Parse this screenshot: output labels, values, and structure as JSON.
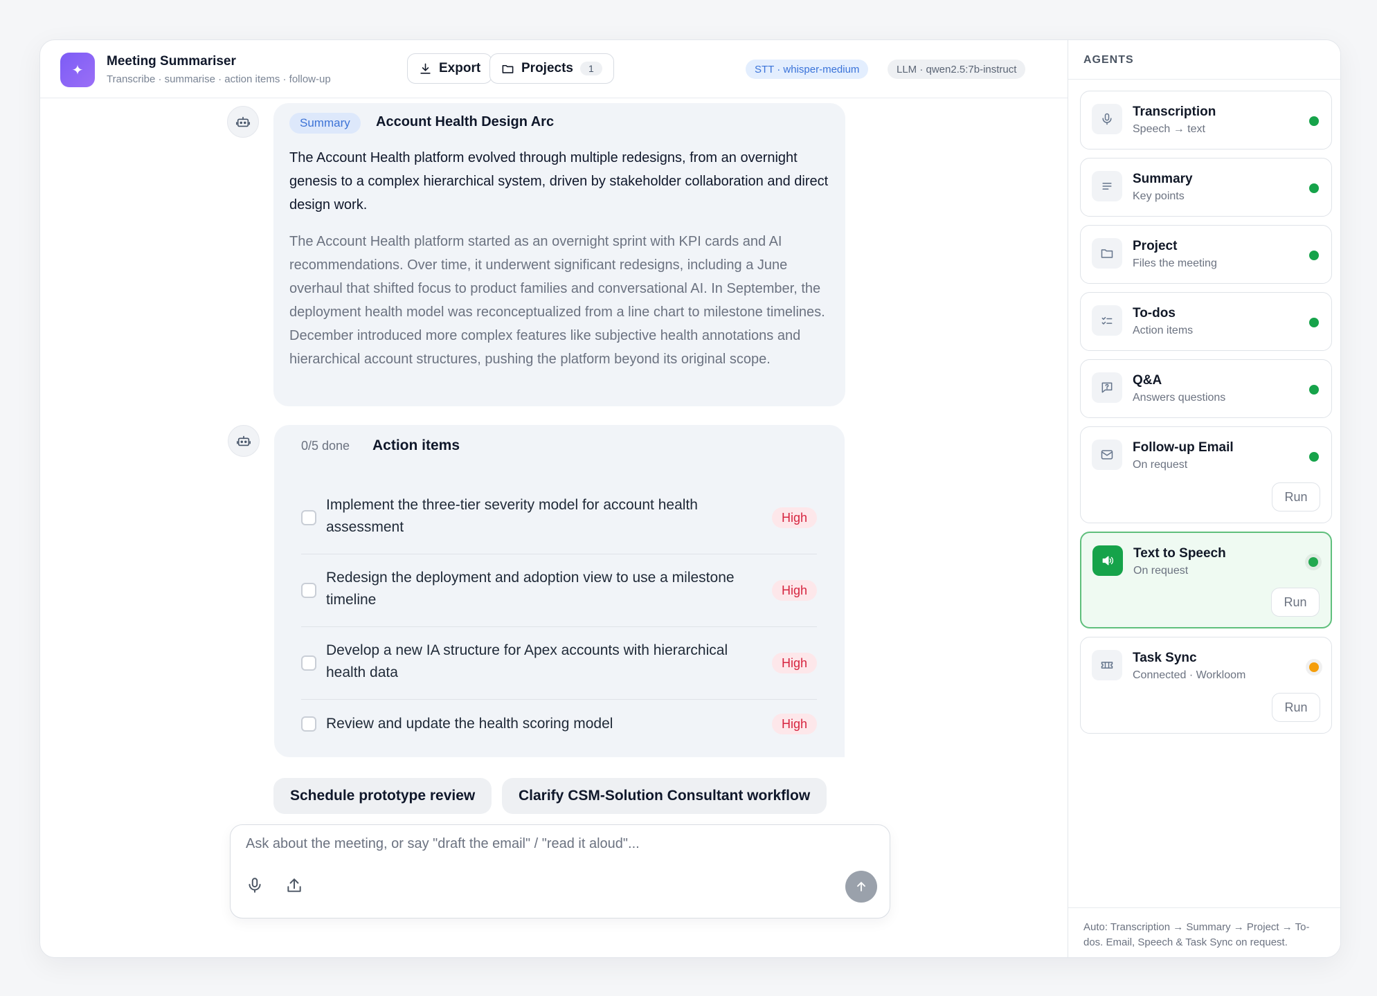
{
  "app": {
    "title": "Meeting Summariser",
    "subtitle": "Transcribe · summarise · action items · follow-up"
  },
  "header": {
    "export_label": "Export",
    "projects_label": "Projects",
    "projects_count": "1",
    "stt_tag": "STT · whisper-medium",
    "llm_tag": "LLM · qwen2.5:7b-instruct"
  },
  "summary": {
    "badge": "Summary",
    "title": "Account Health Design Arc",
    "lead": "The Account Health platform evolved through multiple redesigns, from an overnight genesis to a complex hierarchical system, driven by stakeholder collaboration and direct design work.",
    "body": "The Account Health platform started as an overnight sprint with KPI cards and AI recommendations. Over time, it underwent significant redesigns, including a June overhaul that shifted focus to product families and conversational AI. In September, the deployment health model was reconceptualized from a line chart to milestone timelines. December introduced more complex features like subjective health annotations and hierarchical account structures, pushing the platform beyond its original scope."
  },
  "actions": {
    "done_count": "0/5 done",
    "title": "Action items",
    "items": [
      {
        "text": "Implement the three-tier severity model for account health assessment",
        "priority": "High"
      },
      {
        "text": "Redesign the deployment and adoption view to use a milestone timeline",
        "priority": "High"
      },
      {
        "text": "Develop a new IA structure for Apex accounts with hierarchical health data",
        "priority": "High"
      },
      {
        "text": "Review and update the health scoring model",
        "priority": "High"
      }
    ]
  },
  "suggestions": [
    "Schedule prototype review",
    "Clarify CSM-Solution Consultant workflow"
  ],
  "composer": {
    "placeholder": "Ask about the meeting, or say \"draft the email\" / \"read it aloud\"..."
  },
  "sidebar": {
    "heading": "AGENTS",
    "agents": [
      {
        "name": "Transcription",
        "desc": "Speech → text",
        "icon": "microphone-icon",
        "status_color": "#16a34a"
      },
      {
        "name": "Summary",
        "desc": "Key points",
        "icon": "list-lines-icon",
        "status_color": "#16a34a"
      },
      {
        "name": "Project",
        "desc": "Files the meeting",
        "icon": "folder-icon",
        "status_color": "#16a34a"
      },
      {
        "name": "To-dos",
        "desc": "Action items",
        "icon": "checklist-icon",
        "status_color": "#16a34a"
      },
      {
        "name": "Q&A",
        "desc": "Answers questions",
        "icon": "question-chat-icon",
        "status_color": "#16a34a"
      },
      {
        "name": "Follow-up Email",
        "desc": "On request",
        "icon": "mail-icon",
        "status_color": "#16a34a",
        "run_label": "Run"
      },
      {
        "name": "Text to Speech",
        "desc": "On request",
        "icon": "speaker-icon",
        "status_color": "#22a84f",
        "run_label": "Run"
      },
      {
        "name": "Task Sync",
        "desc": "Connected · Workloom",
        "icon": "ticket-icon",
        "status_color": "#f59e0b",
        "run_label": "Run"
      }
    ],
    "footer": "Auto: Transcription → Summary → Project → To-dos. Email, Speech & Task Sync on request."
  },
  "colors": {
    "accent": "#7c5cf5",
    "active_green": "#16a34a",
    "warning": "#f59e0b",
    "priority_high": "#d6243f"
  }
}
